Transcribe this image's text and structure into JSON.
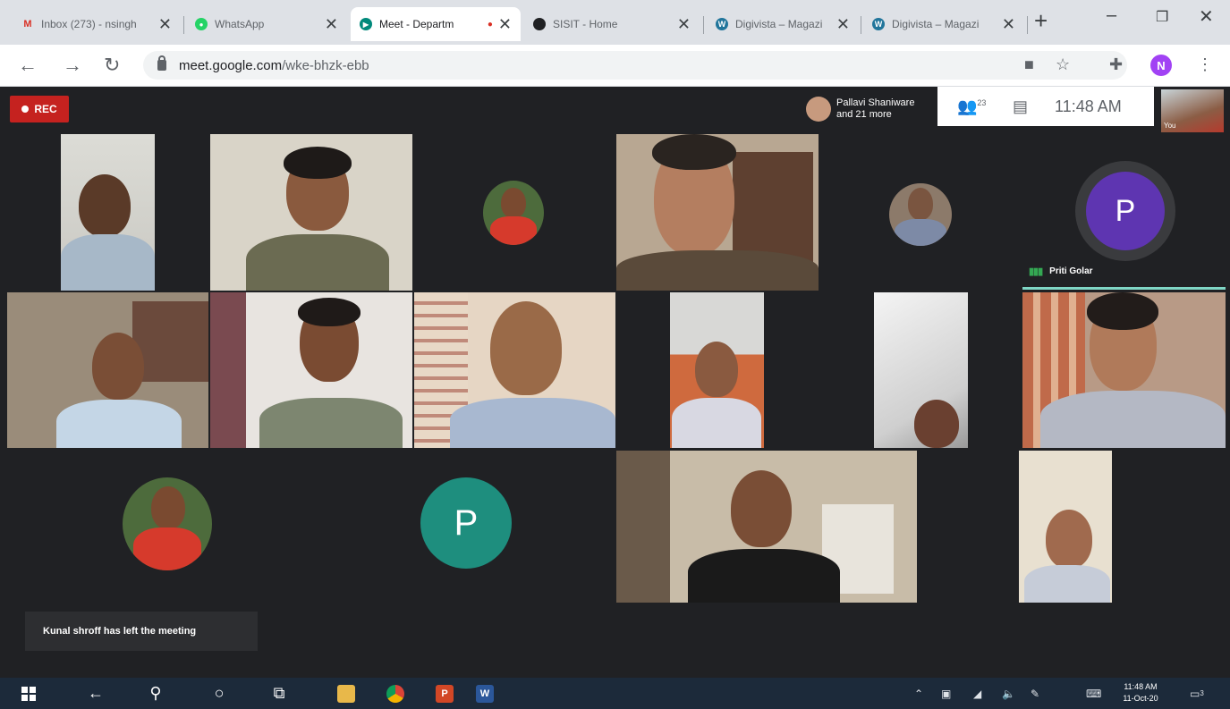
{
  "browser": {
    "tabs": [
      {
        "title": "Inbox (273) - nsingh",
        "icon": "gmail-icon"
      },
      {
        "title": "WhatsApp",
        "icon": "whatsapp-icon"
      },
      {
        "title": "Meet - Departm",
        "icon": "meet-icon",
        "active": true
      },
      {
        "title": "SISIT - Home",
        "icon": "site-icon"
      },
      {
        "title": "Digivista – Magazi",
        "icon": "wordpress-icon"
      },
      {
        "title": "Digivista – Magazi",
        "icon": "wordpress-icon"
      }
    ],
    "url_host": "meet.google.com",
    "url_path": "/wke-bhzk-ebb",
    "profile_initial": "N"
  },
  "meet": {
    "rec_label": "REC",
    "presenter_line1": "Pallavi Shaniware",
    "presenter_line2": "and 21 more",
    "people_count": "23",
    "clock": "11:48 AM",
    "self_label": "You",
    "tiles": {
      "avatar_letter_1": "P",
      "avatar_letter_2": "P",
      "speaking_name": "Priti Golar"
    },
    "toast": "Kunal shroff has left the meeting"
  },
  "taskbar": {
    "time": "11:48 AM",
    "date": "11-Oct-20",
    "notification_count": "3"
  },
  "colors": {
    "rec": "#c5221f",
    "avatar_purple": "#5e35b1",
    "avatar_teal": "#1e8e7e",
    "speaking": "#7fd6c5"
  }
}
